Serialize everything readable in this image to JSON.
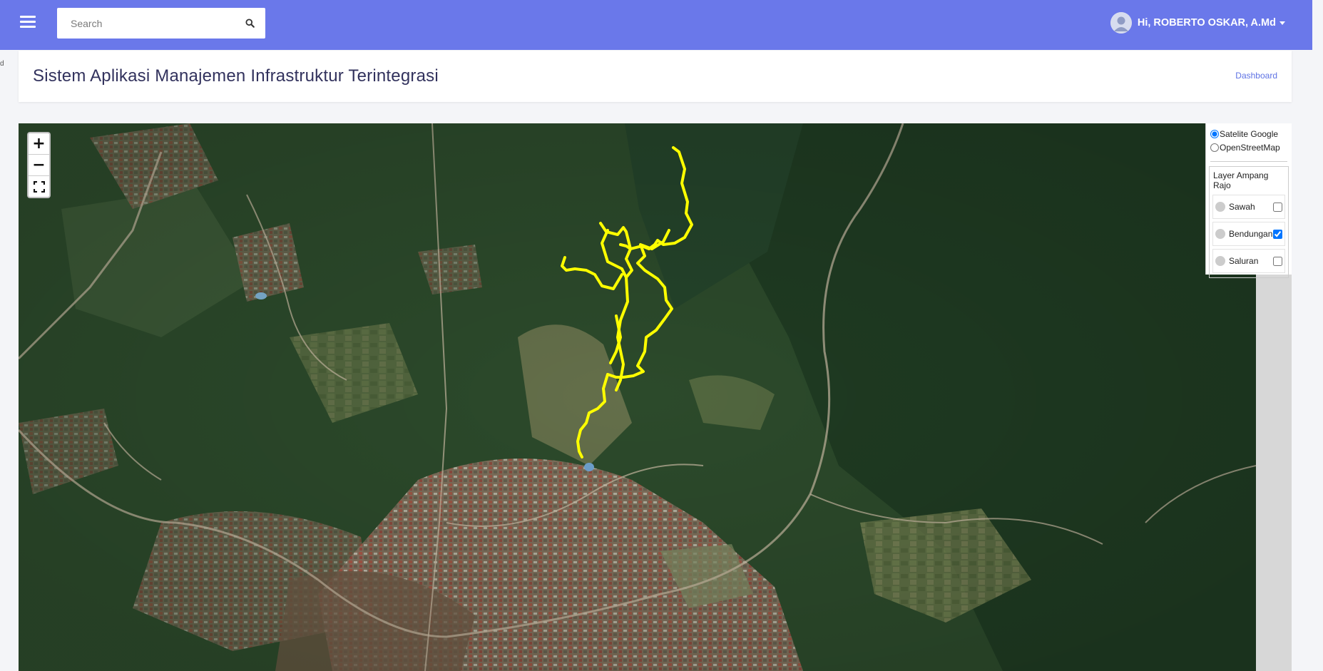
{
  "navbar": {
    "search_placeholder": "Search",
    "user_name": "Hi, ROBERTO OSKAR, A.Md",
    "icons": [
      "hamburger-icon",
      "search-icon",
      "user-avatar-icon",
      "caret-down-icon"
    ],
    "brand_color": "#6a78ea"
  },
  "header": {
    "title": "Sistem Aplikasi Manajemen Infrastruktur Terintegrasi",
    "breadcrumb": "Dashboard"
  },
  "map": {
    "zoom_in": "+",
    "zoom_out": "−",
    "fullscreen_icon": "fullscreen-icon",
    "base_layers": [
      {
        "label": "Satelite Google",
        "selected": true
      },
      {
        "label": "OpenStreetMap",
        "selected": false
      }
    ],
    "overlay_group": {
      "title": "Layer Ampang Rajo",
      "layers": [
        {
          "label": "Sawah",
          "checked": false
        },
        {
          "label": "Bendungan",
          "checked": true
        },
        {
          "label": "Saluran",
          "checked": false
        }
      ]
    },
    "route_color": "#ffff00"
  }
}
